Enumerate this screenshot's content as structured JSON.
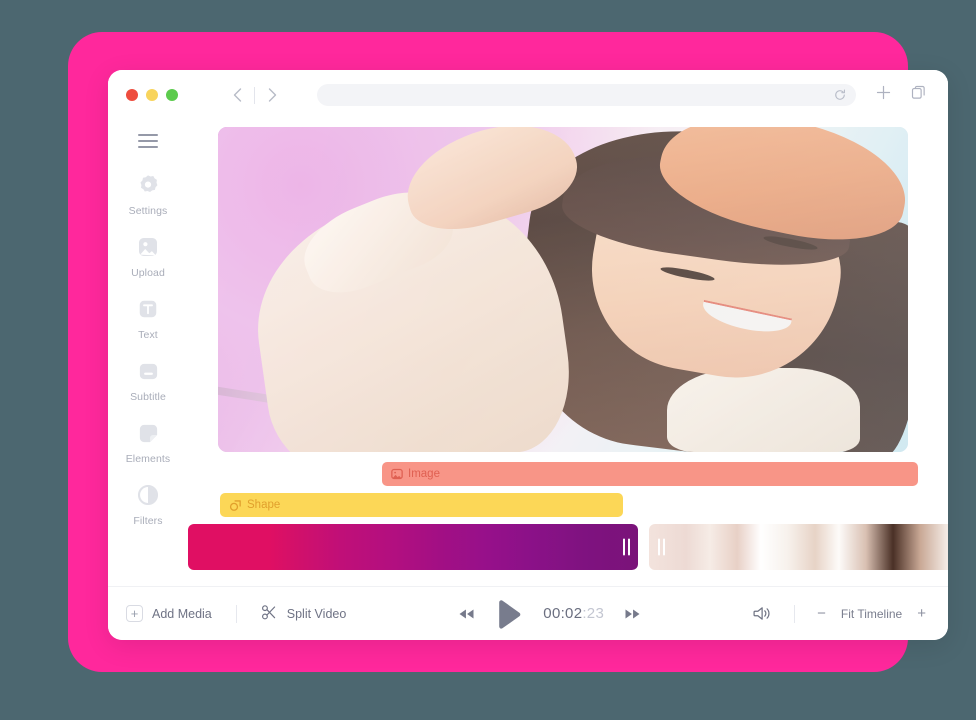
{
  "theme": {
    "background": "#4c6770",
    "frame_accent": "#ff289c",
    "window_bg": "#ffffff"
  },
  "browser": {
    "traffic_lights": [
      {
        "name": "close",
        "color": "#ee4d3e"
      },
      {
        "name": "minimize",
        "color": "#f8d45c"
      },
      {
        "name": "maximize",
        "color": "#5ccb4d"
      }
    ],
    "back_icon": "chevron-left-icon",
    "forward_icon": "chevron-right-icon",
    "url_value": "",
    "url_placeholder": "",
    "reload_icon": "reload-icon",
    "new_tab_icon": "plus-icon",
    "tabs_icon": "copy-tabs-icon"
  },
  "sidebar": {
    "menu_icon": "hamburger-icon",
    "items": [
      {
        "label": "Settings",
        "icon": "settings-icon"
      },
      {
        "label": "Upload",
        "icon": "upload-image-icon"
      },
      {
        "label": "Text",
        "icon": "text-icon"
      },
      {
        "label": "Subtitle",
        "icon": "subtitle-icon"
      },
      {
        "label": "Elements",
        "icon": "elements-icon"
      },
      {
        "label": "Filters",
        "icon": "filters-contrast-icon"
      }
    ]
  },
  "preview": {
    "alt": "smiling-woman-with-beret-photo"
  },
  "timeline": {
    "tracks": [
      {
        "label": "Image",
        "icon": "image-icon",
        "color": "#f89587",
        "text_color": "#df6052"
      },
      {
        "label": "Shape",
        "icon": "shape-icon",
        "color": "#fcd757",
        "text_color": "#e1a02d"
      }
    ],
    "clips": [
      {
        "name": "gradient-video-clip"
      },
      {
        "name": "photo-video-clip"
      }
    ]
  },
  "toolbar": {
    "add_media_label": "Add Media",
    "add_media_icon": "plus-box-icon",
    "split_video_label": "Split Video",
    "split_video_icon": "scissors-icon",
    "rewind_icon": "rewind-icon",
    "play_icon": "play-icon",
    "forward_icon": "fast-forward-icon",
    "timecode_main": "00:02",
    "timecode_frames": ":23",
    "volume_icon": "speaker-icon",
    "zoom_out_label": "−",
    "fit_timeline_label": "Fit Timeline",
    "zoom_in_label": "+"
  }
}
